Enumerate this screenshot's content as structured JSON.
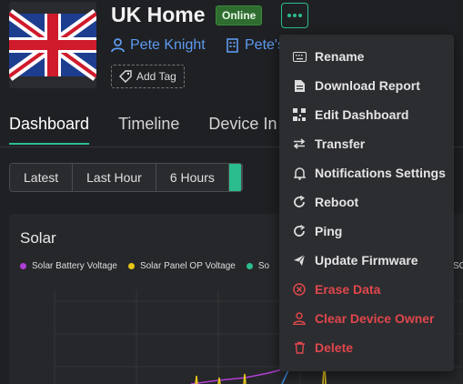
{
  "device": {
    "name": "UK Home",
    "status": "Online",
    "owner": "Pete Knight",
    "org": "Pete's",
    "add_tag_label": "Add Tag"
  },
  "tabs": [
    {
      "label": "Dashboard",
      "active": true
    },
    {
      "label": "Timeline",
      "active": false
    },
    {
      "label": "Device In",
      "active": false
    }
  ],
  "time_ranges": [
    {
      "label": "Latest"
    },
    {
      "label": "Last Hour"
    },
    {
      "label": "6 Hours"
    }
  ],
  "panel": {
    "title": "Solar",
    "legend": [
      {
        "label": "Solar Battery Voltage",
        "color": "#b13fd6"
      },
      {
        "label": "Solar Panel OP Voltage",
        "color": "#e6c619"
      },
      {
        "label": "So",
        "color": "#2bbd8e"
      }
    ],
    "legend_tail": "SC"
  },
  "menu": {
    "items": [
      {
        "label": "Rename",
        "icon": "keyboard-icon",
        "danger": false
      },
      {
        "label": "Download Report",
        "icon": "document-icon",
        "danger": false
      },
      {
        "label": "Edit Dashboard",
        "icon": "qr-icon",
        "danger": false
      },
      {
        "label": "Transfer",
        "icon": "transfer-icon",
        "danger": false
      },
      {
        "label": "Notifications Settings",
        "icon": "bell-icon",
        "danger": false
      },
      {
        "label": "Reboot",
        "icon": "reboot-icon",
        "danger": false
      },
      {
        "label": "Ping",
        "icon": "ping-icon",
        "danger": false
      },
      {
        "label": "Update Firmware",
        "icon": "send-icon",
        "danger": false
      },
      {
        "label": "Erase Data",
        "icon": "erase-icon",
        "danger": true
      },
      {
        "label": "Clear Device Owner",
        "icon": "user-icon",
        "danger": true
      },
      {
        "label": "Delete",
        "icon": "trash-icon",
        "danger": true
      }
    ]
  },
  "colors": {
    "accent": "#2bbd8e",
    "danger": "#e0474c",
    "link": "#5d9af0"
  }
}
